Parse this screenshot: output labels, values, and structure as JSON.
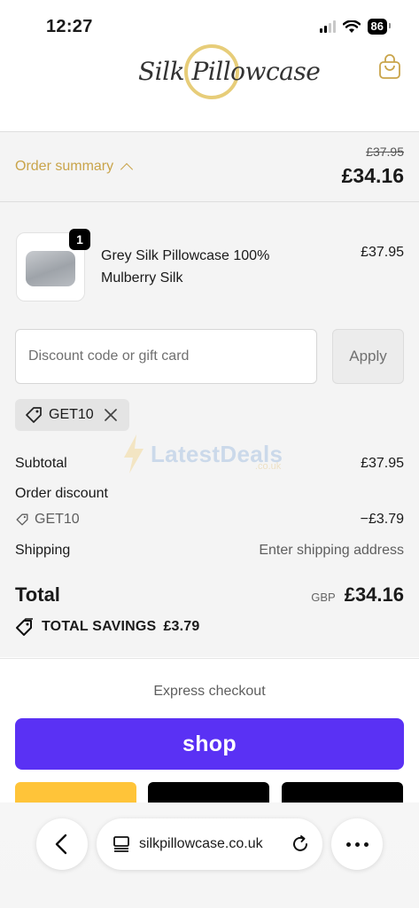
{
  "status_bar": {
    "time": "12:27",
    "battery": "86"
  },
  "header": {
    "logo_text": "Silk Pillowcase",
    "cart_icon": "shopping-bag-icon"
  },
  "summary": {
    "toggle_label": "Order summary",
    "original_total": "£37.95",
    "total": "£34.16"
  },
  "cart": {
    "items": [
      {
        "quantity": "1",
        "name": "Grey Silk Pillowcase 100% Mulberry Silk",
        "price": "£37.95"
      }
    ]
  },
  "discount": {
    "placeholder": "Discount code or gift card",
    "value": "",
    "apply_label": "Apply",
    "applied_code": "GET10"
  },
  "totals": {
    "subtotal_label": "Subtotal",
    "subtotal_value": "£37.95",
    "order_discount_label": "Order discount",
    "discount_code": "GET10",
    "discount_value": "−£3.79",
    "shipping_label": "Shipping",
    "shipping_value": "Enter shipping address",
    "total_label": "Total",
    "currency": "GBP",
    "total_value": "£34.16",
    "savings_label": "TOTAL SAVINGS",
    "savings_value": "£3.79"
  },
  "watermark": {
    "text": "LatestDeals",
    "sub": ".co.uk"
  },
  "express_checkout": {
    "title": "Express checkout",
    "shop_label": "shop"
  },
  "browser": {
    "url": "silkpillowcase.co.uk"
  },
  "colors": {
    "accent_gold": "#c9a44a",
    "shop_purple": "#5a31f4",
    "paypal_yellow": "#ffc439"
  }
}
